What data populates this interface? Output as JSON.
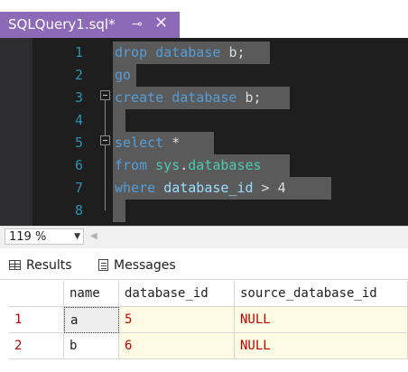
{
  "tab": {
    "title": "SQLQuery1.sql*",
    "pin": "⊸",
    "close": "✕"
  },
  "editor": {
    "line_numbers": [
      "1",
      "2",
      "3",
      "4",
      "5",
      "6",
      "7",
      "8"
    ],
    "lines": [
      [
        {
          "t": "drop",
          "c": "kw"
        },
        {
          "t": " database ",
          "c": "kw"
        },
        {
          "t": "b",
          "c": "tx"
        },
        {
          "t": ";",
          "c": "tx"
        }
      ],
      [
        {
          "t": "go",
          "c": "kw"
        }
      ],
      [
        {
          "t": "create",
          "c": "kw"
        },
        {
          "t": " database ",
          "c": "kw"
        },
        {
          "t": "b",
          "c": "tx"
        },
        {
          "t": ";",
          "c": "tx"
        }
      ],
      [
        {
          "t": "",
          "c": "tx"
        }
      ],
      [
        {
          "t": "select",
          "c": "kw"
        },
        {
          "t": " *",
          "c": "tx"
        }
      ],
      [
        {
          "t": "from",
          "c": "kw"
        },
        {
          "t": " ",
          "c": "tx"
        },
        {
          "t": "sys",
          "c": "sys"
        },
        {
          "t": ".",
          "c": "tx"
        },
        {
          "t": "databases",
          "c": "sys"
        }
      ],
      [
        {
          "t": "where",
          "c": "kw"
        },
        {
          "t": " ",
          "c": "tx"
        },
        {
          "t": "database_id",
          "c": "col"
        },
        {
          "t": " > ",
          "c": "tx"
        },
        {
          "t": "4",
          "c": "tx"
        }
      ],
      [
        {
          "t": "",
          "c": "tx"
        }
      ]
    ]
  },
  "zoom": {
    "value": "119 %"
  },
  "results_tabs": {
    "results": "Results",
    "messages": "Messages"
  },
  "grid": {
    "columns": [
      "",
      "name",
      "database_id",
      "source_database_id"
    ],
    "rows": [
      [
        "1",
        "a",
        "5",
        "NULL"
      ],
      [
        "2",
        "b",
        "6",
        "NULL"
      ]
    ]
  },
  "colors": {
    "tab_accent": "#8d6ab8",
    "editor_bg": "#1e1e1e",
    "keyword": "#569cd6",
    "line_number": "#2b91af",
    "null_text": "#c00000"
  }
}
